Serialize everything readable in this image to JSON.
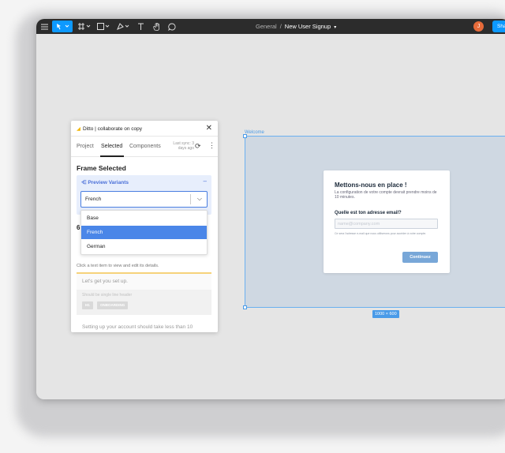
{
  "toolbar": {
    "breadcrumb_parent": "General",
    "breadcrumb_separator": "/",
    "breadcrumb_current": "New User Signup",
    "avatar_initial": "J",
    "share_label": "Sha"
  },
  "plugin": {
    "title": "Ditto | collaborate on copy",
    "tabs": [
      "Project",
      "Selected",
      "Components"
    ],
    "active_tab": "Selected",
    "last_sync": "Last sync: 3 days ago",
    "section_title": "Frame Selected",
    "preview_variants_label": "Preview Variants",
    "selected_variant": "French",
    "variant_options": [
      "Base",
      "French",
      "German"
    ],
    "partial_count": "6",
    "hint": "Click a text item to view and edit its details.",
    "card_text": "Let's get you set up.",
    "card_note": "Should be single line header",
    "card_tags": [
      "H1",
      "ONBOARDING"
    ],
    "bottom_text": "Setting up your account should take less than 10"
  },
  "frame": {
    "label": "Welcome",
    "size_badge": "1000 × 600",
    "modal": {
      "title": "Mettons-nous en place !",
      "subtitle": "La configuration de votre compte devrait prendre moins de 10 minutes.",
      "field_label": "Quelle est ton adresse email?",
      "field_placeholder": "name@company.com",
      "note": "Ce sera l'adresse e-mail que nous utiliserons pour accéder à votre compte.",
      "button": "Continuez"
    }
  },
  "colors": {
    "accent": "#0d99ff",
    "toolbar_bg": "#2c2c2c",
    "frame_bg": "#cfd8e2",
    "selected_option": "#4a86e8"
  }
}
